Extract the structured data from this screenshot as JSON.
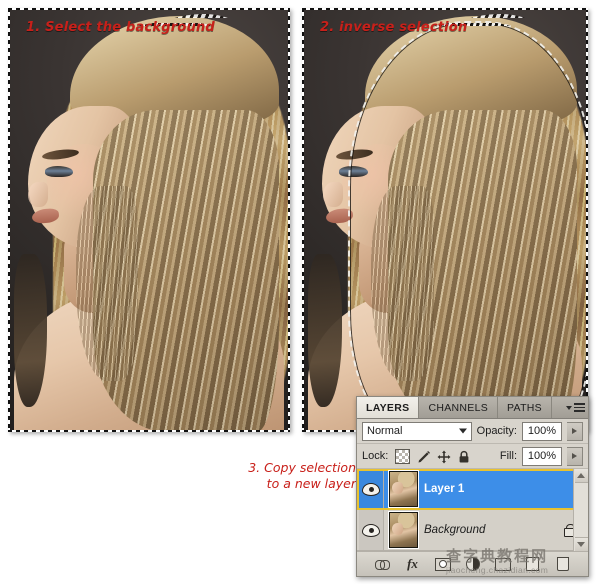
{
  "meta": {
    "app": "Adobe Photoshop",
    "kind": "tutorial-screenshot",
    "accent_selected": "#3d8ee8",
    "accent_highlight": "#e8c230",
    "annotation_color": "#c8201a",
    "panel_bg": "#d4d0c8"
  },
  "steps": {
    "step1_label": "1. Select the background",
    "step2_label": "2. inverse selection",
    "step3_label": "3. Copy selection\nto a new layer"
  },
  "layers_panel": {
    "tabs": [
      {
        "label": "LAYERS",
        "active": true
      },
      {
        "label": "CHANNELS",
        "active": false
      },
      {
        "label": "PATHS",
        "active": false
      }
    ],
    "panel_menu_icon": "panel-menu-icon",
    "blend_mode": {
      "value": "Normal",
      "caret_icon": "chevron-down-icon"
    },
    "opacity": {
      "label": "Opacity:",
      "value": "100%",
      "stepper_icon": "chevron-right-icon"
    },
    "lock": {
      "label": "Lock:",
      "icons": [
        "lock-transparent-pixels-icon",
        "lock-image-pixels-icon",
        "lock-position-icon",
        "lock-all-icon"
      ]
    },
    "fill": {
      "label": "Fill:",
      "value": "100%",
      "stepper_icon": "chevron-right-icon"
    },
    "layers": [
      {
        "name": "Layer 1",
        "selected": true,
        "visible": true,
        "italic": false,
        "locked": false
      },
      {
        "name": "Background",
        "selected": false,
        "visible": true,
        "italic": true,
        "locked": true
      }
    ],
    "scrollbar": {
      "up_icon": "scroll-up-arrow-icon",
      "down_icon": "scroll-down-arrow-icon"
    },
    "bottom_buttons": [
      "link-layers-icon",
      "layer-style-fx-icon",
      "add-layer-mask-icon",
      "adjustment-layer-icon",
      "new-group-icon",
      "new-layer-icon",
      "delete-layer-icon"
    ]
  },
  "watermark": {
    "cn_text": "查字典教程网",
    "url_text": "jiaocheng.chazidian.com"
  }
}
